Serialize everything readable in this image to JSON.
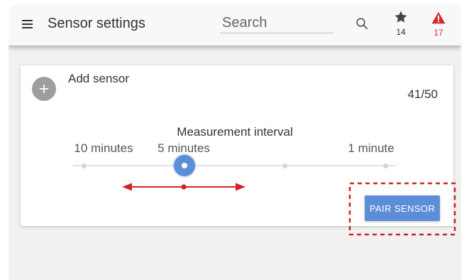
{
  "colors": {
    "accent": "#5b8ed6",
    "alert": "#d9262c",
    "annotation": "#d42128",
    "text": "#333333"
  },
  "header": {
    "menu_icon": "menu-icon",
    "title": "Sensor settings",
    "search": {
      "placeholder": "Search",
      "value": "",
      "icon": "search-icon"
    },
    "favorites": {
      "icon": "star-icon",
      "count": 14
    },
    "alerts": {
      "icon": "warning-icon",
      "count": 17
    }
  },
  "sensor_card": {
    "add_icon": "plus-icon",
    "add_label": "Add sensor",
    "sensor_count": "41/50",
    "interval": {
      "title": "Measurement interval",
      "labels": [
        "10 minutes",
        "5 minutes",
        "1 minute"
      ],
      "step": 2,
      "steps": 4
    },
    "pair_button_label": "PAIR SENSOR"
  }
}
